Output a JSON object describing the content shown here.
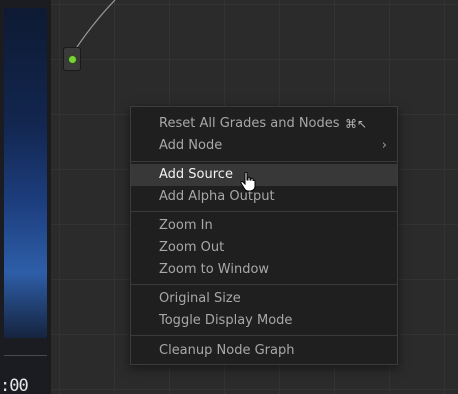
{
  "viewer": {
    "timecode": ":00"
  },
  "menu": {
    "items": [
      {
        "label": "Reset All Grades and Nodes",
        "shortcut": "⌘↖"
      },
      {
        "label": "Add Node",
        "submenu_icon": "›"
      },
      {
        "label": "Add Source"
      },
      {
        "label": "Add Alpha Output"
      },
      {
        "label": "Zoom In"
      },
      {
        "label": "Zoom Out"
      },
      {
        "label": "Zoom to Window"
      },
      {
        "label": "Original Size"
      },
      {
        "label": "Toggle Display Mode"
      },
      {
        "label": "Cleanup Node Graph"
      }
    ],
    "highlighted": "Add Source"
  },
  "colors": {
    "node_dot": "#7bd13a",
    "menu_bg": "#1f1f20",
    "highlight_bg": "#383839"
  }
}
